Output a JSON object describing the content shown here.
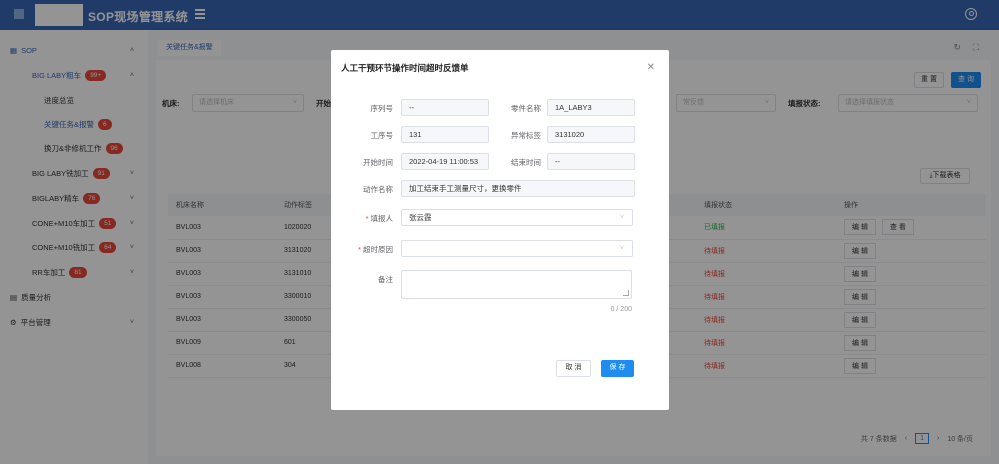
{
  "header": {
    "title": "SOP现场管理系统"
  },
  "sidebar": {
    "items": [
      {
        "label": "SOP",
        "chevron": "˄"
      },
      {
        "label": "BIG LABY粗车",
        "badge": "99+",
        "chevron": "˄"
      },
      {
        "label": "进度总览"
      },
      {
        "label": "关键任务&报警",
        "badge": "6"
      },
      {
        "label": "换刀&非修机工作",
        "badge": "96"
      },
      {
        "label": "BIG LABY铣加工",
        "badge": "91",
        "chevron": "˅"
      },
      {
        "label": "BIGLABY精车",
        "badge": "76",
        "chevron": "˅"
      },
      {
        "label": "CONE+M10车加工",
        "badge": "51",
        "chevron": "˅"
      },
      {
        "label": "CONE+M10铣加工",
        "badge": "64",
        "chevron": "˅"
      },
      {
        "label": "RR车加工",
        "badge": "81",
        "chevron": "˅"
      },
      {
        "label": "质量分析"
      },
      {
        "label": "平台管理",
        "chevron": "˅"
      }
    ]
  },
  "main": {
    "tab": "关键任务&报警",
    "reset_label": "重 置",
    "search_label": "查 询",
    "filters": {
      "machine_label": "机床:",
      "machine_placeholder": "请选择机床",
      "start_label": "开始",
      "feedback_placeholder": "常反馈",
      "status_label": "填报状态:",
      "status_placeholder": "请选择填报状态"
    },
    "download_label": "下载表格",
    "table": {
      "headers": [
        "机床名称",
        "动作标签",
        "",
        "",
        "",
        "填报状态",
        "操作"
      ],
      "rows": [
        {
          "machine": "BVL003",
          "tag": "1020020",
          "status": "已填报",
          "status_color": "#2bb24c",
          "actions": [
            "编 辑",
            "查 看"
          ]
        },
        {
          "machine": "BVL003",
          "tag": "3131020",
          "status": "待填报",
          "status_color": "#e5483b",
          "actions": [
            "编 辑"
          ]
        },
        {
          "machine": "BVL003",
          "tag": "3131010",
          "status": "待填报",
          "status_color": "#e5483b",
          "actions": [
            "编 辑"
          ]
        },
        {
          "machine": "BVL003",
          "tag": "3300010",
          "status": "待填报",
          "status_color": "#e5483b",
          "actions": [
            "编 辑"
          ]
        },
        {
          "machine": "BVL003",
          "tag": "3300050",
          "status": "待填报",
          "status_color": "#e5483b",
          "actions": [
            "编 辑"
          ]
        },
        {
          "machine": "BVL009",
          "tag": "601",
          "status": "待填报",
          "status_color": "#e5483b",
          "actions": [
            "编 辑"
          ]
        },
        {
          "machine": "BVL008",
          "tag": "304",
          "status": "待填报",
          "status_color": "#e5483b",
          "actions": [
            "编 辑"
          ]
        }
      ]
    },
    "pager": {
      "total": "共 7 条数据",
      "current": "1",
      "page_size": "10 条/页"
    }
  },
  "modal": {
    "title": "人工干预环节操作时间超时反馈单",
    "serial_label": "序列号",
    "serial_value": "--",
    "part_label": "零件名称",
    "part_value": "1A_LABY3",
    "step_label": "工序号",
    "step_value": "131",
    "abnormal_label": "异常标签",
    "abnormal_value": "3131020",
    "start_label": "开始时间",
    "start_value": "2022-04-19 11:00:53",
    "end_label": "结束时间",
    "end_value": "--",
    "action_label": "动作名称",
    "action_value": "加工结束手工测量尺寸，更换零件",
    "reporter_label": "填报人",
    "reporter_value": "张云霞",
    "reason_label": "超时原因",
    "reason_value": "",
    "note_label": "备注",
    "counter": "0 / 200",
    "cancel_label": "取 消",
    "save_label": "保 存"
  },
  "colors": {
    "header_bg": "#3a66b3",
    "primary": "#1f8cf0",
    "danger": "#e5483b",
    "success": "#2bb24c"
  }
}
